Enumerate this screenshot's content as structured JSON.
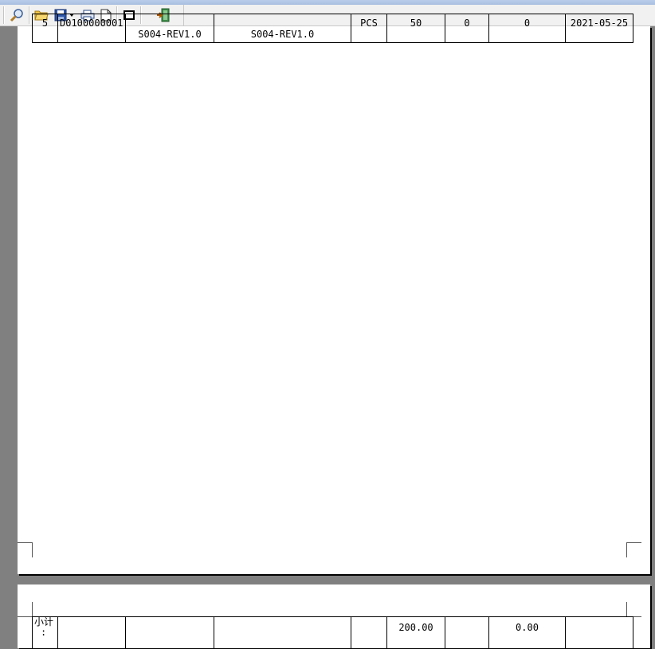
{
  "toolbar": {
    "buttons": [
      {
        "icon": "zoom-icon"
      },
      {
        "icon": "open-folder-icon"
      },
      {
        "icon": "save-icon"
      },
      {
        "icon": "dropdown-arrow-icon"
      },
      {
        "icon": "print-icon"
      },
      {
        "icon": "page-setup-icon"
      },
      {
        "icon": "fit-page-icon"
      },
      {
        "icon": "exit-icon"
      }
    ]
  },
  "table_row": {
    "cells": [
      "5",
      "D0100000001",
      "S004-REV1.0",
      "S004-REV1.0",
      "PCS",
      "50",
      "0",
      "0",
      "2021-05-25"
    ]
  },
  "subtotal": {
    "label_line1": "小计",
    "label_line2": ":",
    "qty_total": "200.00",
    "amount_total": "0.00"
  }
}
